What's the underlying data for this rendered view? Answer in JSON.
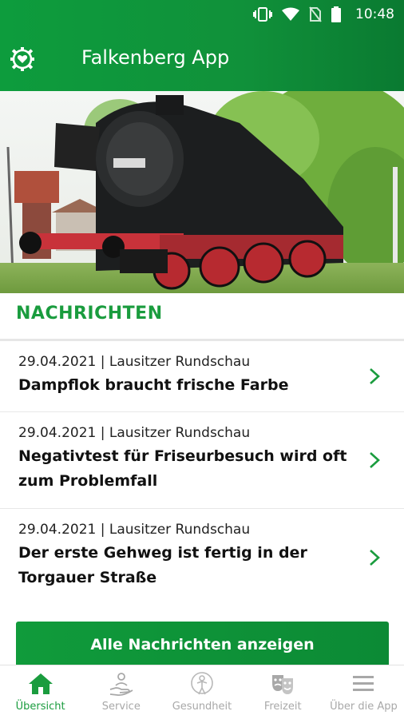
{
  "status_bar": {
    "time": "10:48"
  },
  "app_bar": {
    "title": "Falkenberg App",
    "icon": "heart-gear-icon"
  },
  "news": {
    "heading": "NACHRICHTEN",
    "items": [
      {
        "meta": "29.04.2021 | Lausitzer Rundschau",
        "title": "Dampflok braucht frische Farbe"
      },
      {
        "meta": "29.04.2021 | Lausitzer Rundschau",
        "title": "Negativtest für Friseurbesuch wird oft zum Problemfall"
      },
      {
        "meta": "29.04.2021 | Lausitzer Rundschau",
        "title": "Der erste Gehweg ist fertig in der Torgauer Straße"
      }
    ],
    "all_button": "Alle Nachrichten anzeigen"
  },
  "bottom_nav": [
    {
      "label": "Übersicht",
      "icon": "home-icon",
      "active": true
    },
    {
      "label": "Service",
      "icon": "service-hand-icon",
      "active": false
    },
    {
      "label": "Gesundheit",
      "icon": "health-icon",
      "active": false
    },
    {
      "label": "Freizeit",
      "icon": "theater-masks-icon",
      "active": false
    },
    {
      "label": "Über die App",
      "icon": "menu-icon",
      "active": false
    }
  ],
  "colors": {
    "primary": "#1a9c3e",
    "nav_inactive": "#a8a8a8"
  }
}
